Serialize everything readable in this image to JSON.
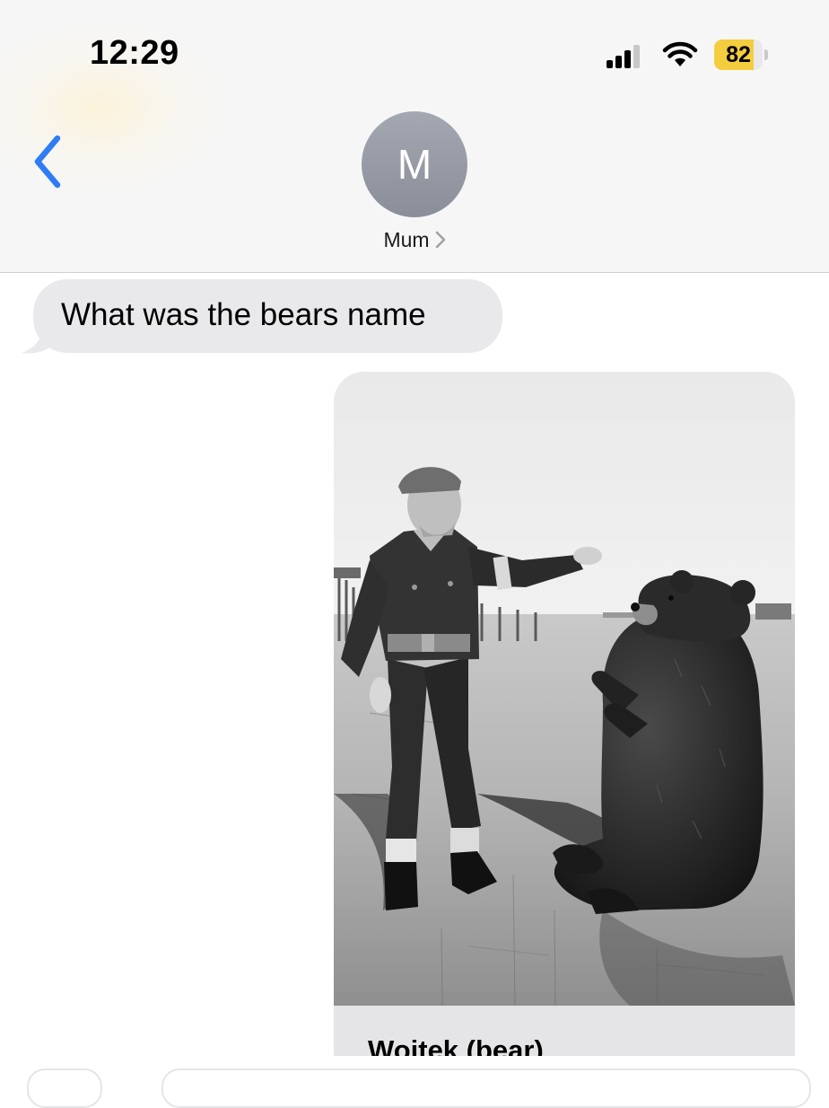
{
  "status_bar": {
    "time": "12:29",
    "battery_level": "82",
    "battery_fraction": 0.82,
    "battery_color": "#f4cd3e",
    "signal_bars_filled": 3,
    "signal_bars_total": 4,
    "signal_icon": "cellular-signal-icon",
    "wifi_icon": "wifi-icon"
  },
  "nav": {
    "back_icon": "chevron-left-icon",
    "accent_color": "#2f7cf6",
    "avatar_initial": "M",
    "contact_name": "Mum",
    "contact_chevron_icon": "chevron-right-icon"
  },
  "messages": [
    {
      "direction": "incoming",
      "text": "What was the bears name"
    },
    {
      "direction": "outgoing",
      "type": "link-preview",
      "image_icon": "photo-soldier-with-bear",
      "title": "Wojtek (bear)"
    }
  ]
}
